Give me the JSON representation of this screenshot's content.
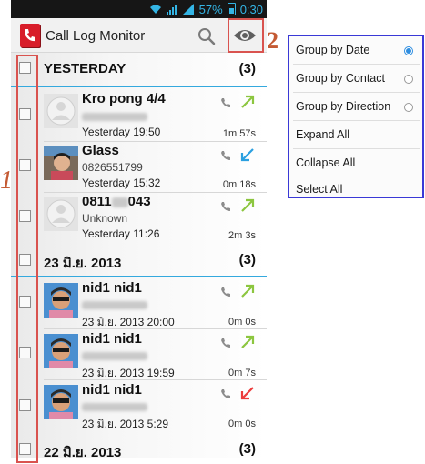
{
  "status_bar": {
    "battery": "57%",
    "time": "0:30"
  },
  "app": {
    "title": "Call Log Monitor"
  },
  "groups": [
    {
      "title": "YESTERDAY",
      "count": "(3)",
      "entries": [
        {
          "name": "Kro pong 4/4",
          "timestamp": "Yesterday 19:50",
          "duration": "1m 57s",
          "direction": "outgoing",
          "avatar": "default-avatar"
        },
        {
          "name": "Glass",
          "number": "0826551799",
          "timestamp": "Yesterday 15:32",
          "duration": "0m 18s",
          "direction": "incoming",
          "avatar": "photo-avatar"
        },
        {
          "name": "0811",
          "name_suffix": "043",
          "label": "Unknown",
          "timestamp": "Yesterday 11:26",
          "duration": "2m 3s",
          "direction": "outgoing",
          "avatar": "default-avatar"
        }
      ]
    },
    {
      "title": "23 มิ.ย. 2013",
      "count": "(3)",
      "entries": [
        {
          "name": "nid1 nid1",
          "timestamp": "23 มิ.ย. 2013 20:00",
          "duration": "0m 0s",
          "direction": "outgoing",
          "avatar": "photo-avatar"
        },
        {
          "name": "nid1 nid1",
          "timestamp": "23 มิ.ย. 2013 19:59",
          "duration": "0m 7s",
          "direction": "outgoing",
          "avatar": "photo-avatar"
        },
        {
          "name": "nid1 nid1",
          "timestamp": "23 มิ.ย. 2013 5:29",
          "duration": "0m 0s",
          "direction": "missed",
          "avatar": "photo-avatar"
        }
      ]
    },
    {
      "title": "22 มิ.ย. 2013",
      "count": "(3)"
    }
  ],
  "annotations": {
    "marker_1": "1",
    "marker_2": "2"
  },
  "menu": {
    "items": [
      {
        "label": "Group by Date",
        "radio": "selected"
      },
      {
        "label": "Group by Contact",
        "radio": "unselected"
      },
      {
        "label": "Group by Direction",
        "radio": "unselected"
      },
      {
        "label": "Expand All"
      },
      {
        "label": "Collapse All"
      },
      {
        "label": "Select All"
      }
    ]
  },
  "colors": {
    "accent_divider": "#34a9de",
    "outgoing_arrow": "#8cc63f",
    "incoming_arrow": "#2ba0e0",
    "missed_arrow": "#ec3b3b",
    "annotation_red": "#d9534f",
    "menu_border": "#3a39d6"
  },
  "icons": [
    "phone-app-icon",
    "search-icon",
    "eye-icon",
    "handset-icon",
    "outgoing-arrow-icon",
    "incoming-arrow-icon",
    "missed-arrow-icon",
    "wifi-icon",
    "signal-icon",
    "battery-icon"
  ]
}
